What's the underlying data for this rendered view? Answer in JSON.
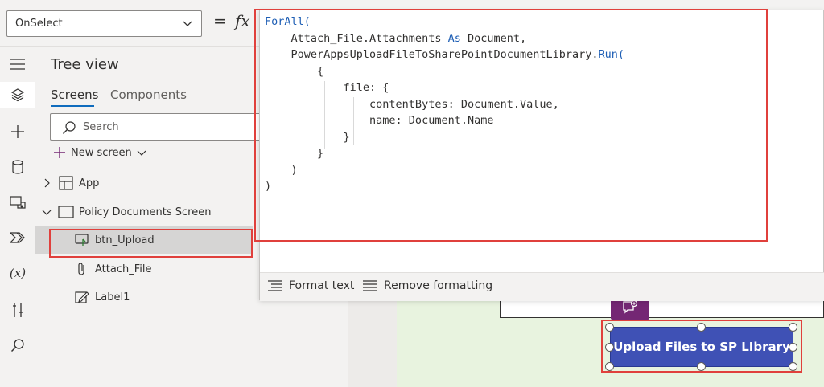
{
  "formula_bar": {
    "property": "OnSelect",
    "equals": "=",
    "fx": "fx"
  },
  "tree": {
    "title": "Tree view",
    "tabs": [
      {
        "label": "Screens",
        "active": true
      },
      {
        "label": "Components",
        "active": false
      }
    ],
    "search_placeholder": "Search",
    "new_screen": "New screen",
    "items": [
      {
        "label": "App",
        "icon": "app-icon"
      },
      {
        "label": "Policy Documents Screen",
        "icon": "screen-icon"
      },
      {
        "label": "btn_Upload",
        "icon": "button-icon",
        "selected": true
      },
      {
        "label": "Attach_File",
        "icon": "paperclip-icon"
      },
      {
        "label": "Label1",
        "icon": "label-edit-icon"
      }
    ]
  },
  "editor": {
    "lines": [
      {
        "tokens": [
          {
            "t": "ForAll(",
            "k": true
          }
        ]
      },
      {
        "tokens": [
          {
            "t": "    Attach_File.Attachments "
          },
          {
            "t": "As",
            "k": true
          },
          {
            "t": " Document,"
          }
        ]
      },
      {
        "tokens": [
          {
            "t": "    PowerAppsUploadFileToSharePointDocumentLibrary."
          },
          {
            "t": "Run(",
            "k": true
          }
        ]
      },
      {
        "tokens": [
          {
            "t": "        {"
          }
        ]
      },
      {
        "tokens": [
          {
            "t": "            file: {"
          }
        ]
      },
      {
        "tokens": [
          {
            "t": "                contentBytes: Document.Value,"
          }
        ]
      },
      {
        "tokens": [
          {
            "t": "                name: Document.Name"
          }
        ]
      },
      {
        "tokens": [
          {
            "t": "            }"
          }
        ]
      },
      {
        "tokens": [
          {
            "t": "        }"
          }
        ]
      },
      {
        "tokens": [
          {
            "t": "    )"
          }
        ]
      },
      {
        "tokens": [
          {
            "t": ")"
          }
        ]
      }
    ],
    "format_text": "Format text",
    "remove_formatting": "Remove formatting"
  },
  "canvas": {
    "upload_button_label": "Upload Files to SP LIbrary"
  },
  "colors": {
    "highlight": "#e0403c",
    "button": "#3f51b5",
    "comment": "#742774",
    "keyword": "#1f5fb5"
  }
}
